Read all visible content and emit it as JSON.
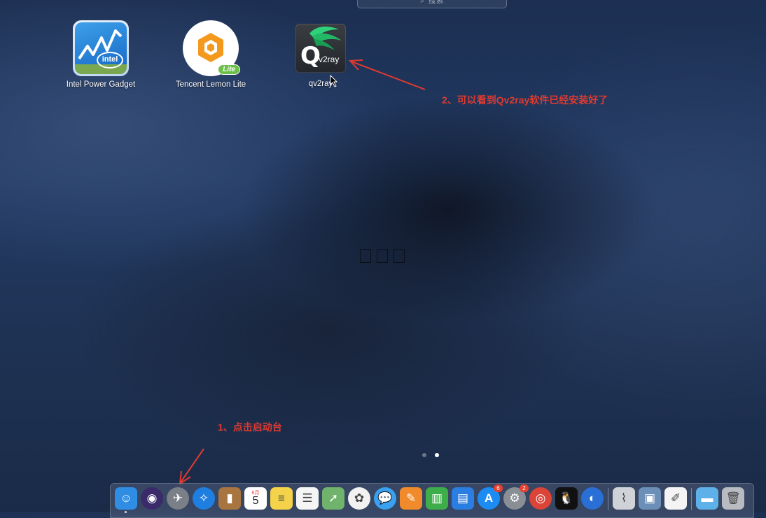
{
  "search": {
    "placeholder": "搜索",
    "icon": "search-icon"
  },
  "apps": [
    {
      "name": "Intel Power Gadget",
      "icon": "intel-power-gadget-icon",
      "badge_text": "intel"
    },
    {
      "name": "Tencent Lemon Lite",
      "icon": "tencent-lemon-lite-icon",
      "badge_text": "Lite"
    },
    {
      "name": "qv2ray",
      "icon": "qv2ray-icon",
      "logo_letter": "Q",
      "logo_text": "v2ray"
    }
  ],
  "annotations": {
    "step1": "1、点击启动台",
    "step2": "2、可以看到Qv2ray软件已经安装好了",
    "color": "#e03a2f"
  },
  "pagination": {
    "total_pages": 2,
    "current_page": 2
  },
  "dock": {
    "items": [
      {
        "name": "Finder",
        "icon": "finder-icon",
        "color": "#2f8de4"
      },
      {
        "name": "Siri",
        "icon": "siri-icon",
        "color": "#3a2a6a"
      },
      {
        "name": "Launchpad",
        "icon": "launchpad-rocket-icon",
        "color": "#7a7f88"
      },
      {
        "name": "Safari",
        "icon": "safari-compass-icon",
        "color": "#1f7fe0"
      },
      {
        "name": "Contacts",
        "icon": "contacts-book-icon",
        "color": "#a8743f"
      },
      {
        "name": "Calendar",
        "icon": "calendar-icon",
        "color": "#ffffff",
        "month": "6月",
        "day": "5"
      },
      {
        "name": "Notes",
        "icon": "notes-icon",
        "color": "#f4d34a"
      },
      {
        "name": "Reminders",
        "icon": "reminders-icon",
        "color": "#f5f5f5"
      },
      {
        "name": "Maps",
        "icon": "maps-icon",
        "color": "#6fb36c"
      },
      {
        "name": "Photos",
        "icon": "photos-flower-icon",
        "color": "#f2f2f2"
      },
      {
        "name": "Messages",
        "icon": "messages-bubble-icon",
        "color": "#3aa0f0"
      },
      {
        "name": "Pages",
        "icon": "pages-icon",
        "color": "#f08a2a"
      },
      {
        "name": "Numbers",
        "icon": "numbers-chart-icon",
        "color": "#3dae4a"
      },
      {
        "name": "Keynote",
        "icon": "keynote-podium-icon",
        "color": "#2a7de1"
      },
      {
        "name": "App Store",
        "icon": "app-store-icon",
        "color": "#1d8cf2",
        "badge": "6"
      },
      {
        "name": "System Preferences",
        "icon": "system-preferences-gear-icon",
        "color": "#8a8f96",
        "badge": "2"
      },
      {
        "name": "Google Chrome",
        "icon": "chrome-icon",
        "color": "#db4437"
      },
      {
        "name": "QQ",
        "icon": "qq-penguin-icon",
        "color": "#111111"
      },
      {
        "name": "Microsoft Edge",
        "icon": "edge-icon",
        "color": "#2a6fd6"
      },
      {
        "name": "Wireless Diagnostics",
        "icon": "wireless-diagnostics-icon",
        "color": "#cfd3d8"
      },
      {
        "name": "Preview",
        "icon": "preview-icon",
        "color": "#6c8fb8"
      },
      {
        "name": "TextEdit",
        "icon": "textedit-icon",
        "color": "#f4f4f4"
      },
      {
        "name": "Downloads",
        "icon": "downloads-folder-icon",
        "color": "#5eb0e8"
      },
      {
        "name": "Trash",
        "icon": "trash-icon",
        "color": "#b8bcc2"
      }
    ]
  }
}
